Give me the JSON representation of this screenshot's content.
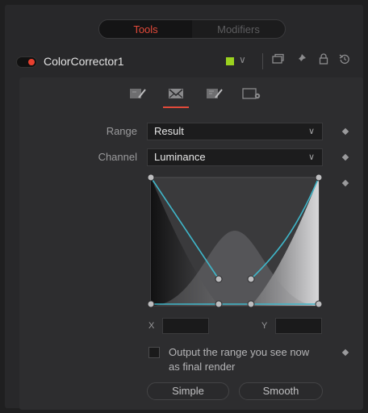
{
  "topbar": {
    "tabs": [
      {
        "label": "Tools"
      },
      {
        "label": "Modifiers"
      }
    ]
  },
  "tool": {
    "name": "ColorCorrector1",
    "color_swatch": "#9bd21f"
  },
  "header_icons": [
    "versions-icon",
    "pin-icon",
    "lock-icon",
    "reset-icon"
  ],
  "panel_tabs": [
    "correction-tab-icon",
    "ranges-tab-icon",
    "options-tab-icon",
    "settings-tab-icon"
  ],
  "fields": {
    "range": {
      "label": "Range",
      "value": "Result"
    },
    "channel": {
      "label": "Channel",
      "value": "Luminance"
    }
  },
  "curve": {
    "x_label": "X",
    "y_label": "Y",
    "x_value": "",
    "y_value": ""
  },
  "output_option": {
    "label_line1": "Output the range you see now",
    "label_line2": "as final render",
    "checked": false
  },
  "buttons": {
    "simple": "Simple",
    "smooth": "Smooth"
  },
  "colors": {
    "accent": "#e24a3a",
    "curve_line": "#3fb6c9"
  }
}
